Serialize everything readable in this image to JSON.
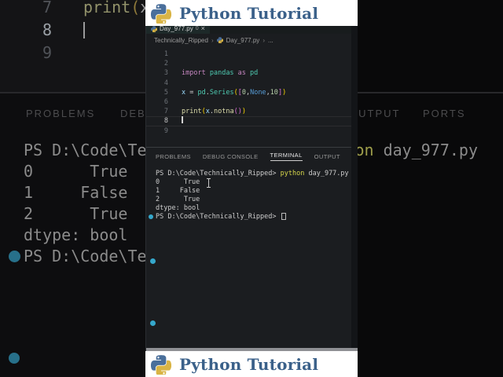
{
  "banner": {
    "title": "Python Tutorial"
  },
  "theme": {
    "banner_bg": "#ffffff",
    "banner_text": "#3b618a",
    "python_logo_blue": "#4a6f9b",
    "python_logo_yellow": "#d9b445",
    "terminal_decoration_dot": "#35a8cc",
    "terminal_yellow": "#d6d64a"
  },
  "window": {
    "tab": {
      "icon": "python-icon",
      "label": "Day_977.py",
      "indicator": "0",
      "close": "×"
    },
    "breadcrumb": {
      "root": "Technically_Ripped",
      "sep": "›",
      "file_icon": "python-icon",
      "file": "Day_977.py",
      "more": "..."
    },
    "editor": {
      "lines": [
        {
          "n": "1",
          "t": []
        },
        {
          "n": "2",
          "t": []
        },
        {
          "n": "3",
          "t": [
            [
              "kw",
              "import"
            ],
            [
              "pl",
              " "
            ],
            [
              "ty",
              "pandas"
            ],
            [
              "kw",
              " as"
            ],
            [
              "ty",
              " pd"
            ]
          ]
        },
        {
          "n": "4",
          "t": []
        },
        {
          "n": "5",
          "t": [
            [
              "vr",
              "x"
            ],
            [
              "pl",
              " = "
            ],
            [
              "ty",
              "pd"
            ],
            [
              "pl",
              "."
            ],
            [
              "ty",
              "Series"
            ],
            [
              "b1",
              "("
            ],
            [
              "b2",
              "["
            ],
            [
              "nu",
              "0"
            ],
            [
              "pl",
              ","
            ],
            [
              "co",
              "None"
            ],
            [
              "pl",
              ","
            ],
            [
              "nu",
              "10"
            ],
            [
              "b2",
              "]"
            ],
            [
              "b1",
              ")"
            ]
          ]
        },
        {
          "n": "6",
          "t": []
        },
        {
          "n": "7",
          "t": [
            [
              "fn",
              "print"
            ],
            [
              "b1",
              "("
            ],
            [
              "vr",
              "x"
            ],
            [
              "pl",
              "."
            ],
            [
              "fn",
              "notna"
            ],
            [
              "b2",
              "("
            ],
            [
              "b2",
              ")"
            ],
            [
              "b1",
              ")"
            ]
          ]
        },
        {
          "n": "8",
          "t": [],
          "current": true
        },
        {
          "n": "9",
          "t": []
        }
      ]
    },
    "panel": {
      "tabs": [
        {
          "label": "PROBLEMS",
          "active": false
        },
        {
          "label": "DEBUG CONSOLE",
          "active": false
        },
        {
          "label": "TERMINAL",
          "active": true
        },
        {
          "label": "OUTPUT",
          "active": false
        },
        {
          "label": "PORTS",
          "active": false
        }
      ],
      "terminal": [
        {
          "t": [
            [
              "fg",
              "PS D:\\Code\\Technically_Ripped> "
            ],
            [
              "yl",
              "python"
            ],
            [
              "fg",
              " day_977.py"
            ]
          ]
        },
        {
          "t": [
            [
              "fg",
              "0      True"
            ]
          ]
        },
        {
          "t": [
            [
              "fg",
              "1     False"
            ]
          ]
        },
        {
          "t": [
            [
              "fg",
              "2      True"
            ]
          ]
        },
        {
          "t": [
            [
              "fg",
              "dtype: bool"
            ]
          ]
        },
        {
          "t": [
            [
              "fg",
              "PS D:\\Code\\Technically_Ripped> "
            ]
          ],
          "dot": true,
          "cursor": true
        }
      ]
    }
  },
  "background": {
    "editor_lines": [
      {
        "n": "7",
        "t": [
          [
            "fn",
            "print"
          ],
          [
            "b1",
            "("
          ],
          [
            "vr",
            "x"
          ]
        ]
      },
      {
        "n": "8",
        "t": [],
        "current": true
      },
      {
        "n": "9",
        "t": []
      }
    ],
    "tabs": [
      {
        "label": "PROBLEMS"
      },
      {
        "label": "DEBUG CONSOLE"
      },
      {
        "label": "OUTPUT"
      },
      {
        "label": "PORTS"
      }
    ],
    "terminal": [
      {
        "t": [
          [
            "fg",
            "PS D:\\Code\\Technically_Ripped> "
          ],
          [
            "yl",
            "python"
          ],
          [
            "fg",
            " day_977.py"
          ]
        ]
      },
      {
        "t": [
          [
            "fg",
            "0      True"
          ]
        ]
      },
      {
        "t": [
          [
            "fg",
            "1     False"
          ]
        ]
      },
      {
        "t": [
          [
            "fg",
            "2      True"
          ]
        ]
      },
      {
        "t": [
          [
            "fg",
            "dtype: bool"
          ]
        ]
      },
      {
        "t": [
          [
            "fg",
            "PS D:\\Code\\Technically_Ripped> "
          ]
        ],
        "dot": true
      }
    ]
  }
}
